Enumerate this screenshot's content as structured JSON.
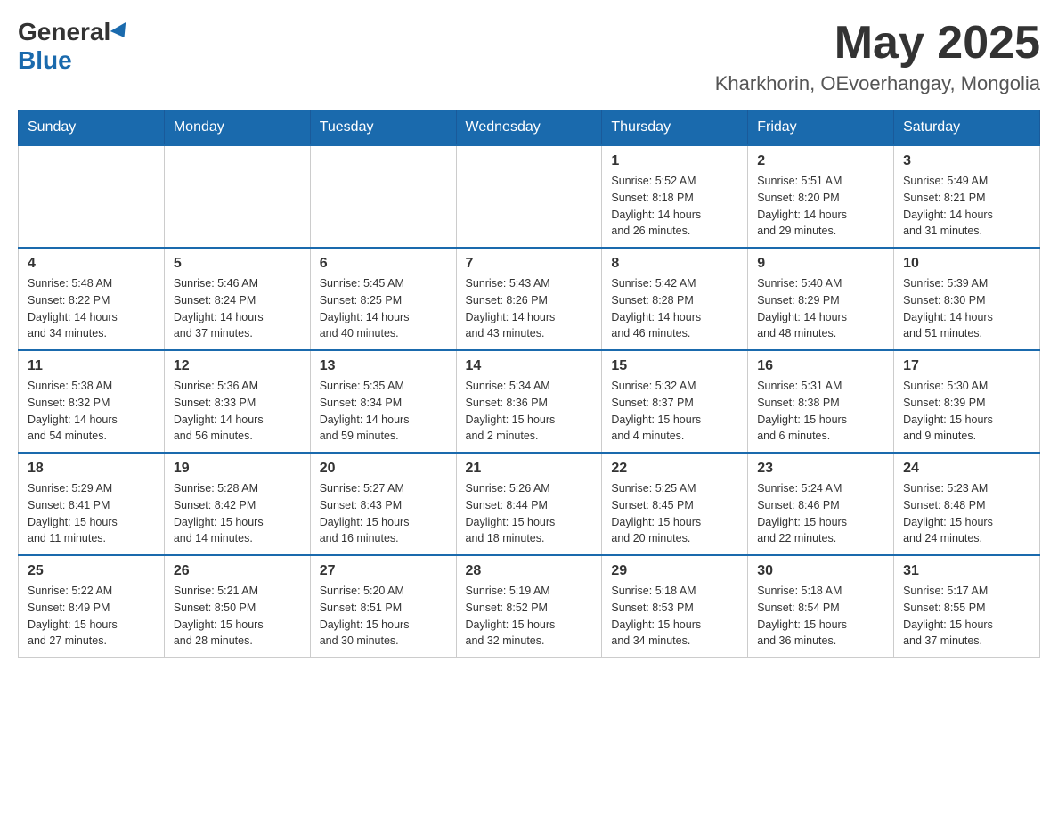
{
  "header": {
    "logo_general": "General",
    "logo_blue": "Blue",
    "month_title": "May 2025",
    "location": "Kharkhorin, OEvoerhangay, Mongolia"
  },
  "weekdays": [
    "Sunday",
    "Monday",
    "Tuesday",
    "Wednesday",
    "Thursday",
    "Friday",
    "Saturday"
  ],
  "weeks": [
    [
      {
        "day": "",
        "info": ""
      },
      {
        "day": "",
        "info": ""
      },
      {
        "day": "",
        "info": ""
      },
      {
        "day": "",
        "info": ""
      },
      {
        "day": "1",
        "info": "Sunrise: 5:52 AM\nSunset: 8:18 PM\nDaylight: 14 hours\nand 26 minutes."
      },
      {
        "day": "2",
        "info": "Sunrise: 5:51 AM\nSunset: 8:20 PM\nDaylight: 14 hours\nand 29 minutes."
      },
      {
        "day": "3",
        "info": "Sunrise: 5:49 AM\nSunset: 8:21 PM\nDaylight: 14 hours\nand 31 minutes."
      }
    ],
    [
      {
        "day": "4",
        "info": "Sunrise: 5:48 AM\nSunset: 8:22 PM\nDaylight: 14 hours\nand 34 minutes."
      },
      {
        "day": "5",
        "info": "Sunrise: 5:46 AM\nSunset: 8:24 PM\nDaylight: 14 hours\nand 37 minutes."
      },
      {
        "day": "6",
        "info": "Sunrise: 5:45 AM\nSunset: 8:25 PM\nDaylight: 14 hours\nand 40 minutes."
      },
      {
        "day": "7",
        "info": "Sunrise: 5:43 AM\nSunset: 8:26 PM\nDaylight: 14 hours\nand 43 minutes."
      },
      {
        "day": "8",
        "info": "Sunrise: 5:42 AM\nSunset: 8:28 PM\nDaylight: 14 hours\nand 46 minutes."
      },
      {
        "day": "9",
        "info": "Sunrise: 5:40 AM\nSunset: 8:29 PM\nDaylight: 14 hours\nand 48 minutes."
      },
      {
        "day": "10",
        "info": "Sunrise: 5:39 AM\nSunset: 8:30 PM\nDaylight: 14 hours\nand 51 minutes."
      }
    ],
    [
      {
        "day": "11",
        "info": "Sunrise: 5:38 AM\nSunset: 8:32 PM\nDaylight: 14 hours\nand 54 minutes."
      },
      {
        "day": "12",
        "info": "Sunrise: 5:36 AM\nSunset: 8:33 PM\nDaylight: 14 hours\nand 56 minutes."
      },
      {
        "day": "13",
        "info": "Sunrise: 5:35 AM\nSunset: 8:34 PM\nDaylight: 14 hours\nand 59 minutes."
      },
      {
        "day": "14",
        "info": "Sunrise: 5:34 AM\nSunset: 8:36 PM\nDaylight: 15 hours\nand 2 minutes."
      },
      {
        "day": "15",
        "info": "Sunrise: 5:32 AM\nSunset: 8:37 PM\nDaylight: 15 hours\nand 4 minutes."
      },
      {
        "day": "16",
        "info": "Sunrise: 5:31 AM\nSunset: 8:38 PM\nDaylight: 15 hours\nand 6 minutes."
      },
      {
        "day": "17",
        "info": "Sunrise: 5:30 AM\nSunset: 8:39 PM\nDaylight: 15 hours\nand 9 minutes."
      }
    ],
    [
      {
        "day": "18",
        "info": "Sunrise: 5:29 AM\nSunset: 8:41 PM\nDaylight: 15 hours\nand 11 minutes."
      },
      {
        "day": "19",
        "info": "Sunrise: 5:28 AM\nSunset: 8:42 PM\nDaylight: 15 hours\nand 14 minutes."
      },
      {
        "day": "20",
        "info": "Sunrise: 5:27 AM\nSunset: 8:43 PM\nDaylight: 15 hours\nand 16 minutes."
      },
      {
        "day": "21",
        "info": "Sunrise: 5:26 AM\nSunset: 8:44 PM\nDaylight: 15 hours\nand 18 minutes."
      },
      {
        "day": "22",
        "info": "Sunrise: 5:25 AM\nSunset: 8:45 PM\nDaylight: 15 hours\nand 20 minutes."
      },
      {
        "day": "23",
        "info": "Sunrise: 5:24 AM\nSunset: 8:46 PM\nDaylight: 15 hours\nand 22 minutes."
      },
      {
        "day": "24",
        "info": "Sunrise: 5:23 AM\nSunset: 8:48 PM\nDaylight: 15 hours\nand 24 minutes."
      }
    ],
    [
      {
        "day": "25",
        "info": "Sunrise: 5:22 AM\nSunset: 8:49 PM\nDaylight: 15 hours\nand 27 minutes."
      },
      {
        "day": "26",
        "info": "Sunrise: 5:21 AM\nSunset: 8:50 PM\nDaylight: 15 hours\nand 28 minutes."
      },
      {
        "day": "27",
        "info": "Sunrise: 5:20 AM\nSunset: 8:51 PM\nDaylight: 15 hours\nand 30 minutes."
      },
      {
        "day": "28",
        "info": "Sunrise: 5:19 AM\nSunset: 8:52 PM\nDaylight: 15 hours\nand 32 minutes."
      },
      {
        "day": "29",
        "info": "Sunrise: 5:18 AM\nSunset: 8:53 PM\nDaylight: 15 hours\nand 34 minutes."
      },
      {
        "day": "30",
        "info": "Sunrise: 5:18 AM\nSunset: 8:54 PM\nDaylight: 15 hours\nand 36 minutes."
      },
      {
        "day": "31",
        "info": "Sunrise: 5:17 AM\nSunset: 8:55 PM\nDaylight: 15 hours\nand 37 minutes."
      }
    ]
  ]
}
